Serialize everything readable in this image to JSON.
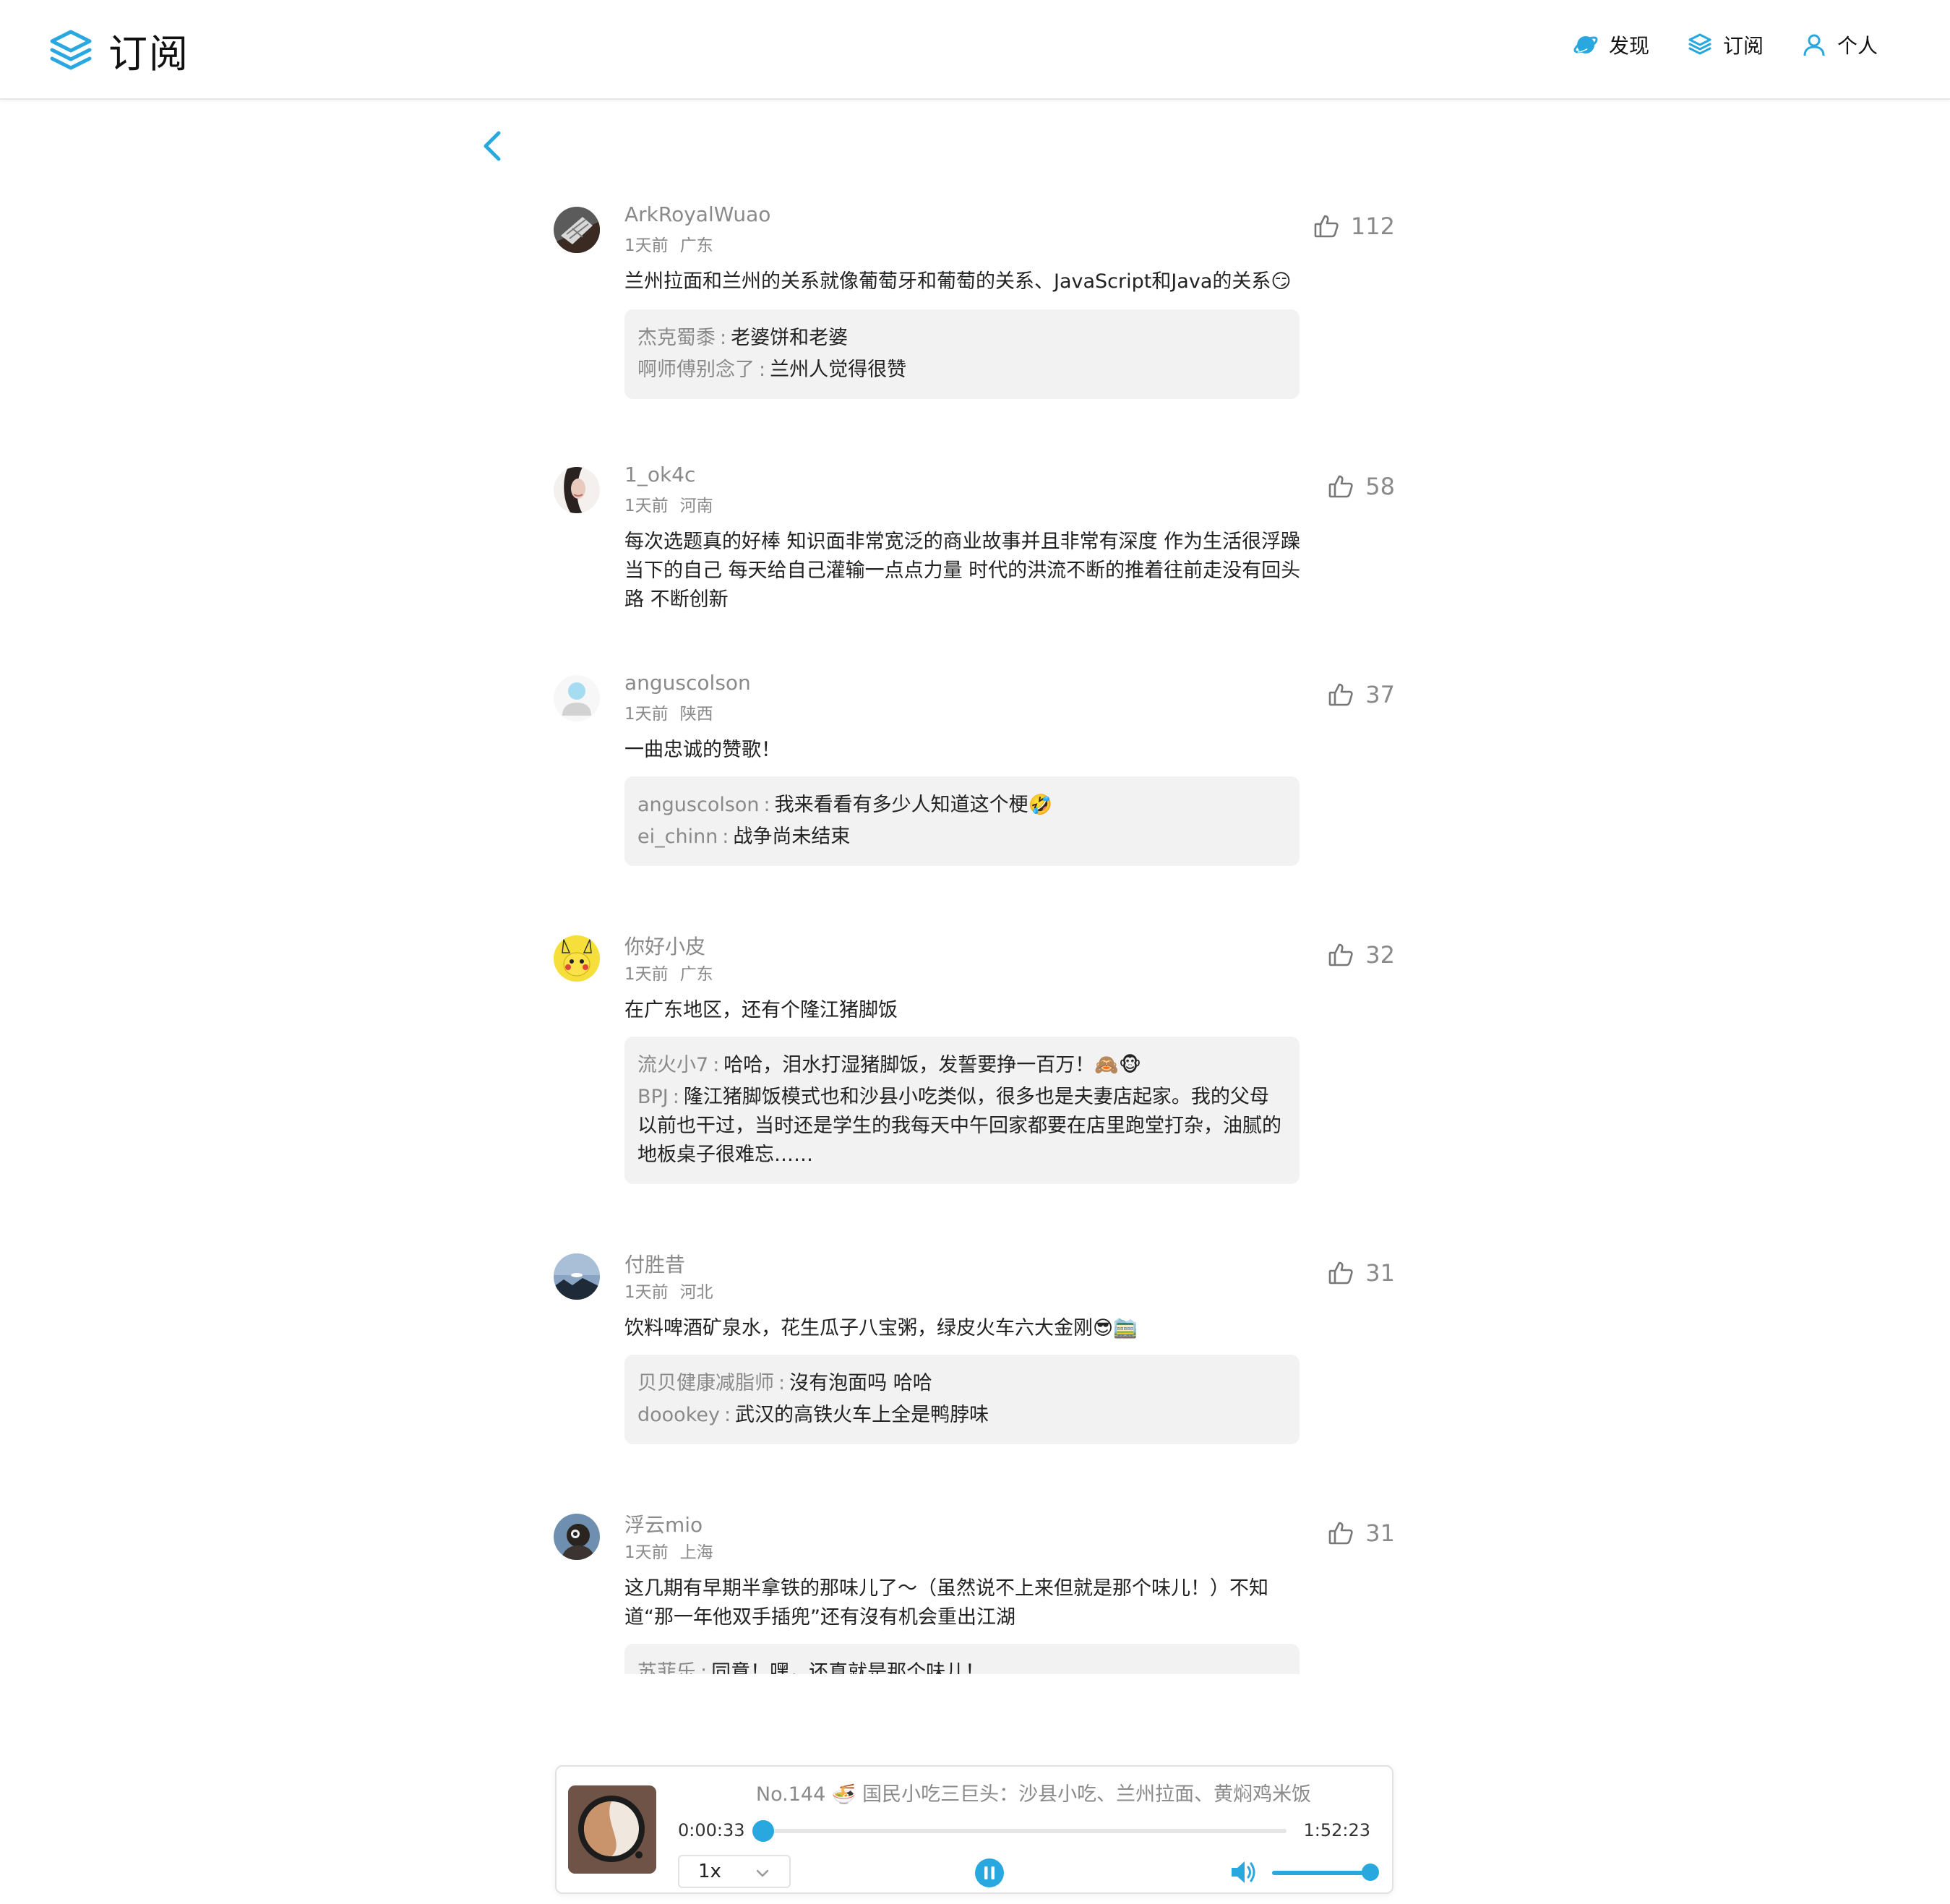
{
  "colors": {
    "accent": "#29a8e0",
    "muted": "#8a8a8a",
    "reply_bg": "#f2f2f2"
  },
  "header": {
    "title": "订阅",
    "logo_icon": "stack-layers-icon",
    "nav": [
      {
        "label": "发现",
        "icon": "planet-icon"
      },
      {
        "label": "订阅",
        "icon": "stack-layers-icon"
      },
      {
        "label": "个人",
        "icon": "user-icon"
      }
    ]
  },
  "back_icon": "chevron-left-icon",
  "comments": [
    {
      "user": "ArkRoyalWuao",
      "time": "1天前",
      "location": "广东",
      "likes": "112",
      "text": "兰州拉面和兰州的关系就像葡萄牙和葡萄的关系、JavaScript和Java的关系😏",
      "replies": [
        {
          "user": "杰克蜀黍",
          "text": "老婆饼和老婆"
        },
        {
          "user": "啊师傅别念了",
          "text": "兰州人觉得很赞"
        }
      ]
    },
    {
      "user": "1_ok4c",
      "time": "1天前",
      "location": "河南",
      "likes": "58",
      "text": "每次选题真的好棒 知识面非常宽泛的商业故事并且非常有深度 作为生活很浮躁当下的自己 每天给自己灌输一点点力量 时代的洪流不断的推着往前走没有回头路 不断创新",
      "replies": []
    },
    {
      "user": "anguscolson",
      "time": "1天前",
      "location": "陕西",
      "likes": "37",
      "text": "一曲忠诚的赞歌！",
      "replies": [
        {
          "user": "anguscolson",
          "text": "我来看看有多少人知道这个梗🤣"
        },
        {
          "user": "ei_chinn",
          "text": "战争尚未结束"
        }
      ]
    },
    {
      "user": "你好小皮",
      "time": "1天前",
      "location": "广东",
      "likes": "32",
      "text": "在广东地区，还有个隆江猪脚饭",
      "replies": [
        {
          "user": "流火小7",
          "text": "哈哈，泪水打湿猪脚饭，发誓要挣一百万！🙈🐵"
        },
        {
          "user": "BPJ",
          "text": "隆江猪脚饭模式也和沙县小吃类似，很多也是夫妻店起家。我的父母以前也干过，当时还是学生的我每天中午回家都要在店里跑堂打杂，油腻的地板桌子很难忘……"
        }
      ]
    },
    {
      "user": "付胜昔",
      "time": "1天前",
      "location": "河北",
      "likes": "31",
      "text": "饮料啤酒矿泉水，花生瓜子八宝粥，绿皮火车六大金刚😎🚞",
      "replies": [
        {
          "user": "贝贝健康减脂师",
          "text": "沒有泡面吗 哈哈"
        },
        {
          "user": "doookey",
          "text": "武汉的高铁火车上全是鸭脖味"
        }
      ]
    },
    {
      "user": "浮云mio",
      "time": "1天前",
      "location": "上海",
      "likes": "31",
      "text": "这几期有早期半拿铁的那味儿了～（虽然说不上来但就是那个味儿！）不知道“那一年他双手插兜”还有沒有机会重出江湖",
      "replies": [
        {
          "user": "苏菲乐",
          "text": "同意！嘿，还真就是那个味儿！"
        }
      ]
    }
  ],
  "player": {
    "title": "No.144 🍜 国民小吃三巨头：沙县小吃、兰州拉面、黄焖鸡米饭",
    "current_time": "0:00:33",
    "total_time": "1:52:23",
    "progress": 0.005,
    "speed": "1x",
    "volume": 1.0,
    "state": "playing",
    "play_icon": "pause-icon",
    "volume_icon": "speaker-icon",
    "speed_icon": "chevron-down-icon"
  }
}
